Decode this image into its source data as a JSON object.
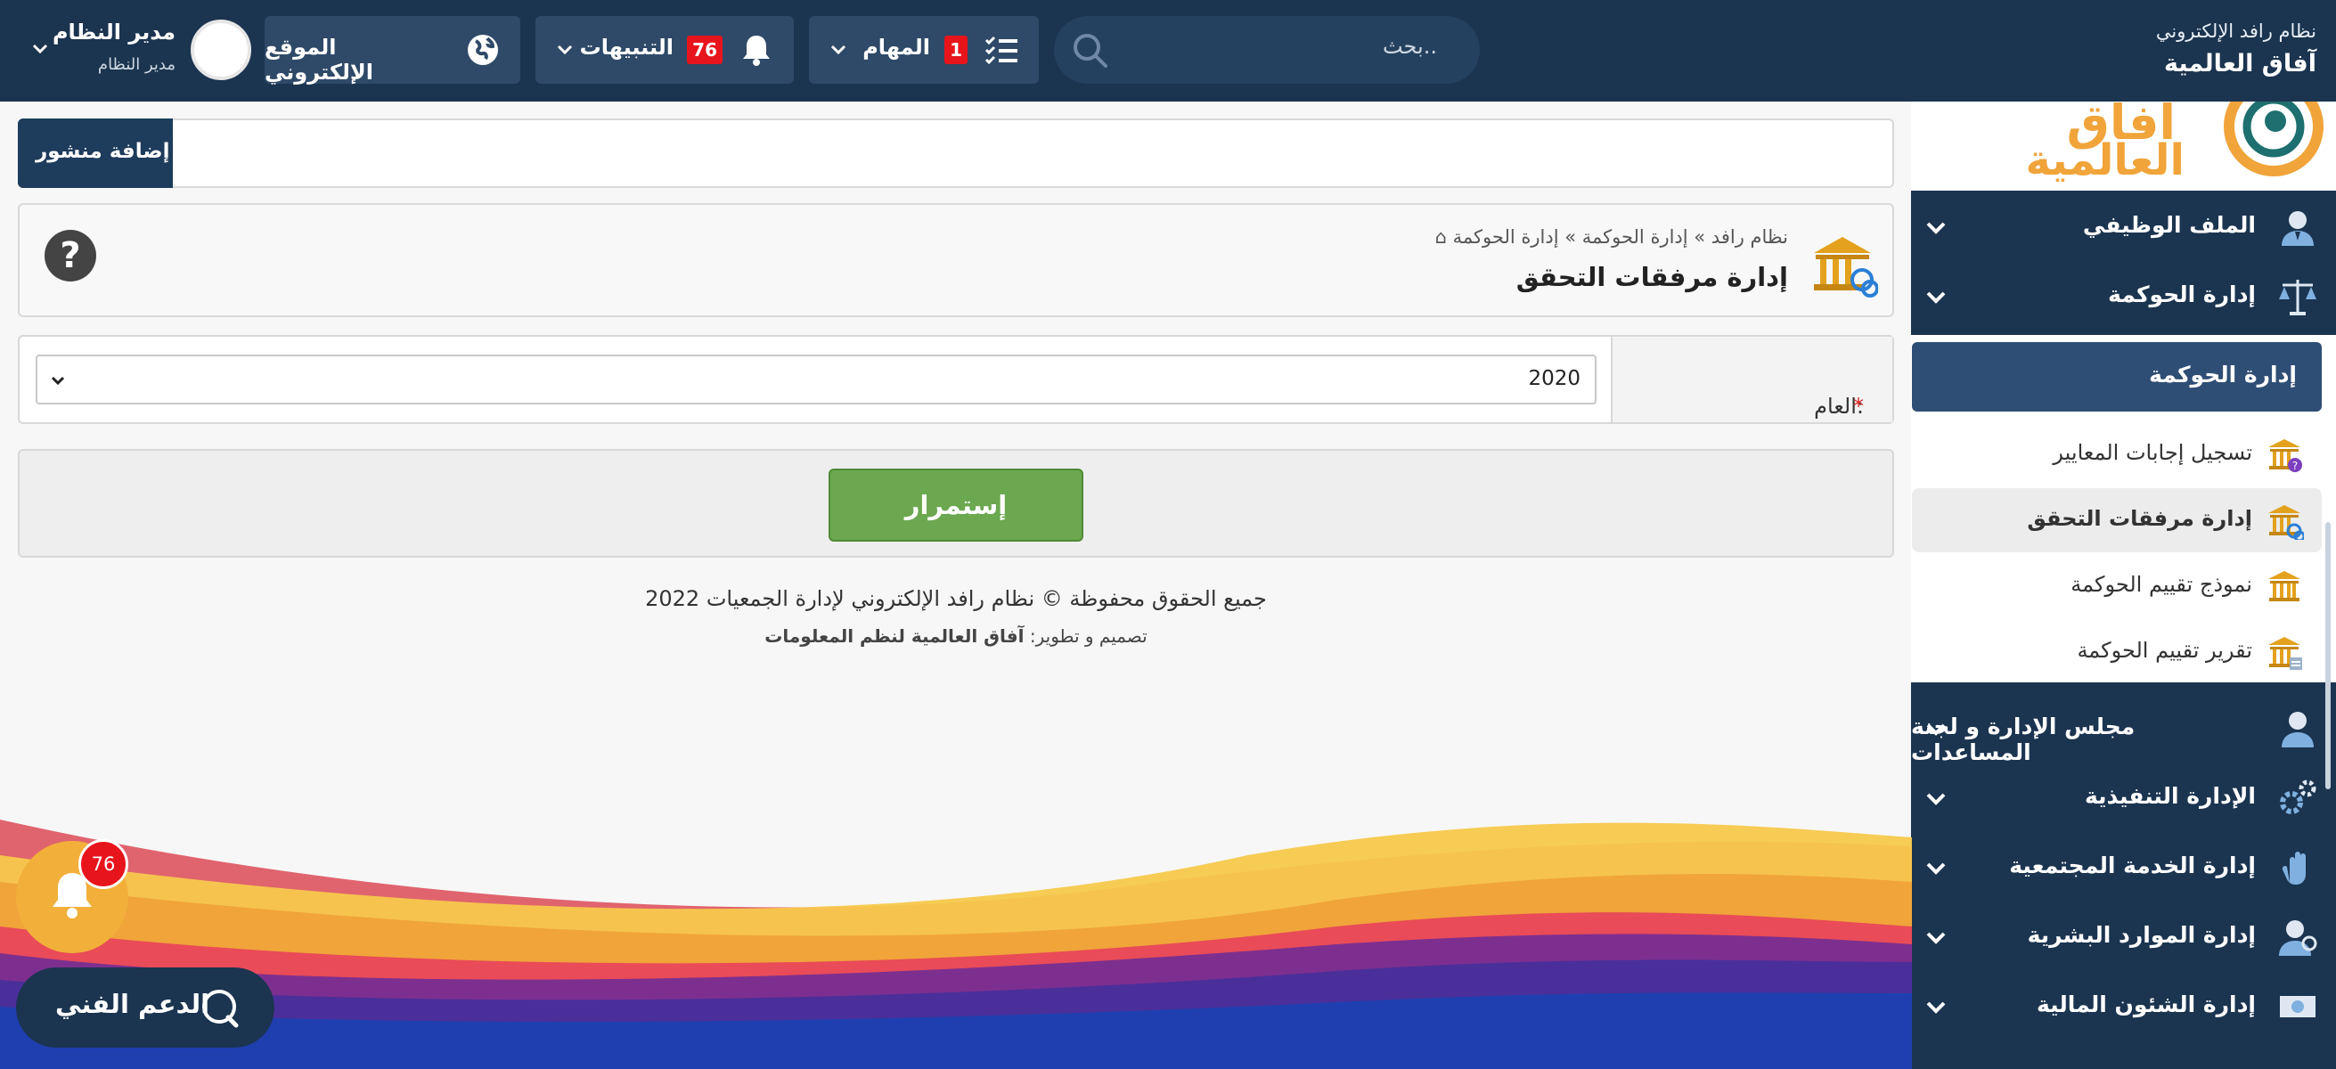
{
  "topbar": {
    "brand_line1": "نظام رافد الإلكتروني",
    "brand_line2": "آفاق العالمية",
    "search_placeholder": "بحث..",
    "tasks_label": "المهام",
    "tasks_count": "1",
    "alerts_label": "التنبيهات",
    "alerts_count": "76",
    "website_label": "الموقع الإلكتروني",
    "user_name": "مدير النظام",
    "user_role": "مدير النظام"
  },
  "sidebar": {
    "logo_text_top": "آفاق",
    "logo_text_bottom": "العالمية",
    "items": [
      {
        "label": "الملف الوظيفي",
        "icon": "employee-icon"
      },
      {
        "label": "إدارة الحوكمة",
        "icon": "scales-icon"
      },
      {
        "label": "مجلس الإدارة و لجنة المساعدات",
        "icon": "board-member-icon"
      },
      {
        "label": "الإدارة التنفيذية",
        "icon": "gears-icon"
      },
      {
        "label": "إدارة الخدمة المجتمعية",
        "icon": "hand-icon"
      },
      {
        "label": "إدارة الموارد البشرية",
        "icon": "hr-icon"
      },
      {
        "label": "إدارة الشئون المالية",
        "icon": "money-icon"
      }
    ],
    "submenu_title": "إدارة الحوكمة",
    "submenu": [
      {
        "label": "تسجيل إجابات المعايير",
        "icon": "building-question-icon"
      },
      {
        "label": "إدارة مرفقات التحقق",
        "icon": "building-link-icon"
      },
      {
        "label": "نموذج تقييم الحوكمة",
        "icon": "building-icon"
      },
      {
        "label": "تقرير تقييم الحوكمة",
        "icon": "building-report-icon"
      }
    ]
  },
  "main": {
    "add_post_label": "إضافة منشور",
    "breadcrumb": "نظام رافد » إدارة الحوكمة » إدارة الحوكمة",
    "page_title": "إدارة مرفقات التحقق",
    "help_symbol": "?",
    "year_label": "العام:",
    "year_required": "*",
    "year_value": "2020",
    "continue_label": "إستمرار"
  },
  "footer": {
    "copyright": "جميع الحقوق محفوظة © نظام رافد الإلكتروني لإدارة الجمعيات 2022",
    "credit_prefix": "تصميم و تطوير:",
    "credit_company": "آفاق العالمية لنظم المعلومات"
  },
  "floating": {
    "notification_count": "76",
    "support_label": "الدعم الفني"
  },
  "colors": {
    "navy": "#1b3450",
    "pill": "#2f4a68",
    "badge_red": "#e8141c",
    "continue_green": "#6ba84f",
    "gold": "#f2b03a"
  }
}
